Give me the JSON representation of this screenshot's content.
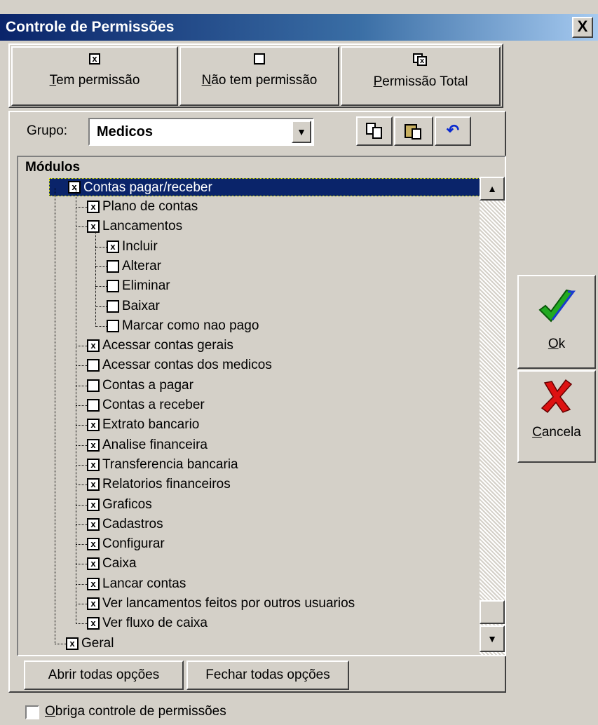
{
  "window": {
    "title": "Controle de Permissões",
    "close_symbol": "X"
  },
  "toolbar": {
    "tem_permissao": {
      "label": "Tem permissão",
      "icon_text": "x"
    },
    "nao_tem_permissao": {
      "label": "Não tem permissão",
      "icon_text": ""
    },
    "permissao_total": {
      "label": "Permissão Total",
      "icon_text": "x"
    }
  },
  "grupo": {
    "label": "Grupo:",
    "value": "Medicos"
  },
  "tree": {
    "header": "Módulos",
    "root": {
      "label": "Contas pagar/receber",
      "checked": true,
      "selected": true
    },
    "items": [
      {
        "label": "Plano de contas",
        "checked": true,
        "level": 2
      },
      {
        "label": "Lancamentos",
        "checked": true,
        "level": 2
      },
      {
        "label": "Incluir",
        "checked": true,
        "level": 3
      },
      {
        "label": "Alterar",
        "checked": false,
        "level": 3
      },
      {
        "label": "Eliminar",
        "checked": false,
        "level": 3
      },
      {
        "label": "Baixar",
        "checked": false,
        "level": 3
      },
      {
        "label": "Marcar como nao pago",
        "checked": false,
        "level": 3
      },
      {
        "label": "Acessar contas gerais",
        "checked": true,
        "level": 2
      },
      {
        "label": "Acessar contas dos medicos",
        "checked": false,
        "level": 2
      },
      {
        "label": "Contas a pagar",
        "checked": false,
        "level": 2
      },
      {
        "label": "Contas a receber",
        "checked": false,
        "level": 2
      },
      {
        "label": "Extrato bancario",
        "checked": true,
        "level": 2
      },
      {
        "label": "Analise financeira",
        "checked": true,
        "level": 2
      },
      {
        "label": "Transferencia bancaria",
        "checked": true,
        "level": 2
      },
      {
        "label": "Relatorios financeiros",
        "checked": true,
        "level": 2
      },
      {
        "label": "Graficos",
        "checked": true,
        "level": 2
      },
      {
        "label": "Cadastros",
        "checked": true,
        "level": 2
      },
      {
        "label": "Configurar",
        "checked": true,
        "level": 2
      },
      {
        "label": "Caixa",
        "checked": true,
        "level": 2
      },
      {
        "label": "Lancar contas",
        "checked": true,
        "level": 2
      },
      {
        "label": "Ver lancamentos feitos por outros usuarios",
        "checked": true,
        "level": 2
      },
      {
        "label": "Ver fluxo de caixa",
        "checked": true,
        "level": 2
      }
    ],
    "last": {
      "label": "Geral",
      "checked": true
    }
  },
  "buttons": {
    "abrir": "Abrir todas opções",
    "fechar": "Fechar todas opções",
    "ok": "Ok",
    "cancela": "Cancela"
  },
  "obriga": {
    "label": "Obriga controle de permissões",
    "checked": false
  },
  "colors": {
    "accent": "#0a246a",
    "ok_green": "#22aa22",
    "cancel_red": "#dd1111"
  }
}
